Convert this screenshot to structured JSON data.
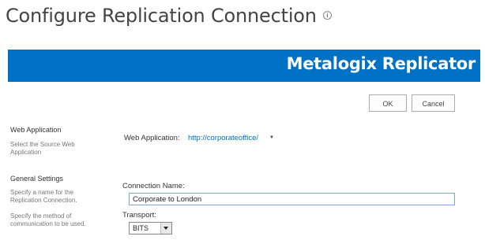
{
  "page": {
    "title": "Configure Replication Connection",
    "info_icon": "info-icon"
  },
  "banner": {
    "logo_text": "Metalogix Replicator",
    "color": "#0072c6"
  },
  "toolbar": {
    "ok_label": "OK",
    "cancel_label": "Cancel"
  },
  "sections": {
    "web_application": {
      "title": "Web Application",
      "description": "Select the Source Web Application",
      "field_label": "Web Application:",
      "field_value": "http://corporateoffice/",
      "dropdown_icon": "chevron-down-icon"
    },
    "general_settings": {
      "title": "General Settings",
      "description_name": "Specify a name for the Replication Connection.",
      "description_transport": "Specify the method of communication to be used.",
      "connection_name_label": "Connection Name:",
      "connection_name_value": "Corporate to London",
      "transport_label": "Transport:",
      "transport_value": "BITS"
    }
  }
}
